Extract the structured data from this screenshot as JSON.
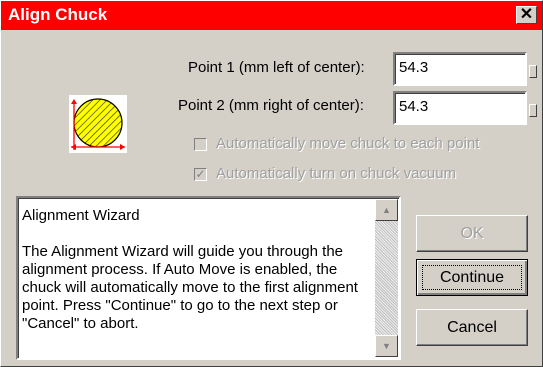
{
  "window": {
    "title": "Align Chuck",
    "close_label": "✕"
  },
  "point1": {
    "label": "Point 1 (mm left of center):",
    "value": "54.3"
  },
  "point2": {
    "label": "Point 2 (mm right of center):",
    "value": "54.3"
  },
  "options": {
    "auto_move_label": "Automatically move chuck to each point",
    "auto_vacuum_label": "Automatically turn on chuck vacuum",
    "auto_move_checked": "",
    "auto_vacuum_checked": "✓"
  },
  "wizard": {
    "heading": "Alignment Wizard",
    "body": "The Alignment Wizard will guide you through the alignment process.  If Auto Move is enabled, the chuck will automatically move to the first alignment point.  Press \"Continue\" to go to the next step or \"Cancel\" to abort.",
    "scroll_up": "▲",
    "scroll_down": "▼"
  },
  "buttons": {
    "ok": "OK",
    "continue": "Continue",
    "cancel": "Cancel"
  },
  "colors": {
    "titlebar": "#ff0000",
    "chuck_fill": "#ffff00",
    "arrow": "#ff0000"
  }
}
